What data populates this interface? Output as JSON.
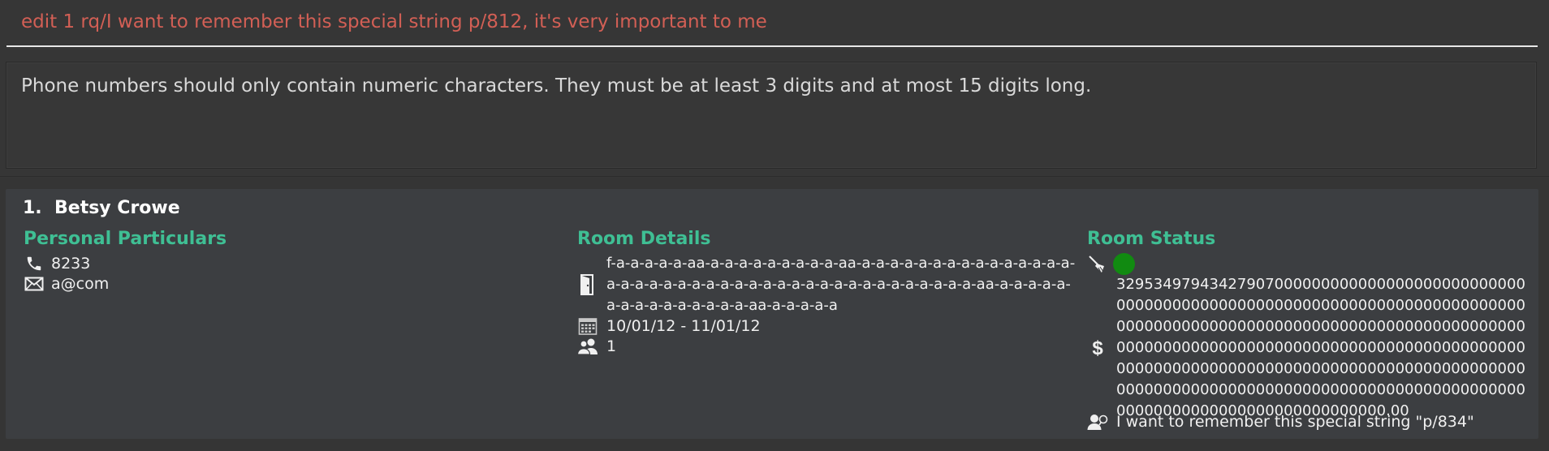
{
  "command_box": {
    "text": "edit 1 rq/I want to remember this special string p/812, it's very important to me"
  },
  "result_box": {
    "text": "Phone numbers should only contain numeric characters. They must be at least 3 digits and at most 15 digits long."
  },
  "person_card": {
    "index": "1.",
    "name": "Betsy Crowe",
    "personal_particulars": {
      "title": "Personal Particulars",
      "phone": "8233",
      "email": "a@com",
      "phone_icon": "phone-icon",
      "email_icon": "envelope-icon"
    },
    "room_details": {
      "title": "Room Details",
      "room": "f-a-a-a-a-a-aa-a-a-a-a-a-a-a-a-a-aa-a-a-a-a-a-a-a-a-a-a-a-a-a-a-a-a-a-a-a-a-a-a-a-a-a-a-a-a-a-a-a-a-a-a-a-a-a-a-a-a-a-aa-a-a-a-a-a-a-a-a-a-a-a-a-a-a-a-aa-a-a-a-a-a",
      "dates": "10/01/12 - 11/01/12",
      "guests": "1",
      "room_icon": "door-icon",
      "dates_icon": "calendar-icon",
      "guests_icon": "people-icon"
    },
    "room_status": {
      "title": "Room Status",
      "cleaning_icon": "broom-icon",
      "cleaning_status_color": "#118a11",
      "price": "32953497943427907000000000000000000000000000000000000000000000000000000000000000000000000000000000000000000000000000000000000000000000000000000000000000000000000000000000000000000000000000000000000000000000000000000000000000000000000000000000000000000000000000000000000000000000000000000000000.00",
      "price_icon": "dollar-icon",
      "request": "I want to remember this special string \"p/834\"",
      "request_icon": "request-icon"
    }
  },
  "colors": {
    "command_text": "#d25f55",
    "section_title": "#3fbf94",
    "background": "#363636",
    "card": "#3c3e41"
  }
}
